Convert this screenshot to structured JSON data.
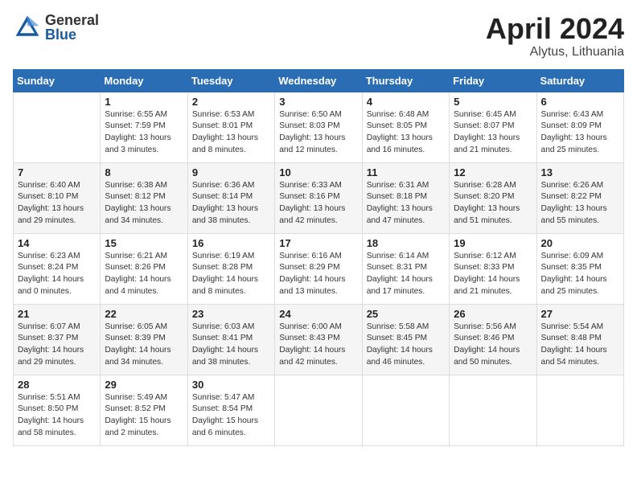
{
  "header": {
    "logo_general": "General",
    "logo_blue": "Blue",
    "month_title": "April 2024",
    "location": "Alytus, Lithuania"
  },
  "days_of_week": [
    "Sunday",
    "Monday",
    "Tuesday",
    "Wednesday",
    "Thursday",
    "Friday",
    "Saturday"
  ],
  "weeks": [
    [
      {
        "day": "",
        "info": ""
      },
      {
        "day": "1",
        "info": "Sunrise: 6:55 AM\nSunset: 7:59 PM\nDaylight: 13 hours\nand 3 minutes."
      },
      {
        "day": "2",
        "info": "Sunrise: 6:53 AM\nSunset: 8:01 PM\nDaylight: 13 hours\nand 8 minutes."
      },
      {
        "day": "3",
        "info": "Sunrise: 6:50 AM\nSunset: 8:03 PM\nDaylight: 13 hours\nand 12 minutes."
      },
      {
        "day": "4",
        "info": "Sunrise: 6:48 AM\nSunset: 8:05 PM\nDaylight: 13 hours\nand 16 minutes."
      },
      {
        "day": "5",
        "info": "Sunrise: 6:45 AM\nSunset: 8:07 PM\nDaylight: 13 hours\nand 21 minutes."
      },
      {
        "day": "6",
        "info": "Sunrise: 6:43 AM\nSunset: 8:09 PM\nDaylight: 13 hours\nand 25 minutes."
      }
    ],
    [
      {
        "day": "7",
        "info": "Sunrise: 6:40 AM\nSunset: 8:10 PM\nDaylight: 13 hours\nand 29 minutes."
      },
      {
        "day": "8",
        "info": "Sunrise: 6:38 AM\nSunset: 8:12 PM\nDaylight: 13 hours\nand 34 minutes."
      },
      {
        "day": "9",
        "info": "Sunrise: 6:36 AM\nSunset: 8:14 PM\nDaylight: 13 hours\nand 38 minutes."
      },
      {
        "day": "10",
        "info": "Sunrise: 6:33 AM\nSunset: 8:16 PM\nDaylight: 13 hours\nand 42 minutes."
      },
      {
        "day": "11",
        "info": "Sunrise: 6:31 AM\nSunset: 8:18 PM\nDaylight: 13 hours\nand 47 minutes."
      },
      {
        "day": "12",
        "info": "Sunrise: 6:28 AM\nSunset: 8:20 PM\nDaylight: 13 hours\nand 51 minutes."
      },
      {
        "day": "13",
        "info": "Sunrise: 6:26 AM\nSunset: 8:22 PM\nDaylight: 13 hours\nand 55 minutes."
      }
    ],
    [
      {
        "day": "14",
        "info": "Sunrise: 6:23 AM\nSunset: 8:24 PM\nDaylight: 14 hours\nand 0 minutes."
      },
      {
        "day": "15",
        "info": "Sunrise: 6:21 AM\nSunset: 8:26 PM\nDaylight: 14 hours\nand 4 minutes."
      },
      {
        "day": "16",
        "info": "Sunrise: 6:19 AM\nSunset: 8:28 PM\nDaylight: 14 hours\nand 8 minutes."
      },
      {
        "day": "17",
        "info": "Sunrise: 6:16 AM\nSunset: 8:29 PM\nDaylight: 14 hours\nand 13 minutes."
      },
      {
        "day": "18",
        "info": "Sunrise: 6:14 AM\nSunset: 8:31 PM\nDaylight: 14 hours\nand 17 minutes."
      },
      {
        "day": "19",
        "info": "Sunrise: 6:12 AM\nSunset: 8:33 PM\nDaylight: 14 hours\nand 21 minutes."
      },
      {
        "day": "20",
        "info": "Sunrise: 6:09 AM\nSunset: 8:35 PM\nDaylight: 14 hours\nand 25 minutes."
      }
    ],
    [
      {
        "day": "21",
        "info": "Sunrise: 6:07 AM\nSunset: 8:37 PM\nDaylight: 14 hours\nand 29 minutes."
      },
      {
        "day": "22",
        "info": "Sunrise: 6:05 AM\nSunset: 8:39 PM\nDaylight: 14 hours\nand 34 minutes."
      },
      {
        "day": "23",
        "info": "Sunrise: 6:03 AM\nSunset: 8:41 PM\nDaylight: 14 hours\nand 38 minutes."
      },
      {
        "day": "24",
        "info": "Sunrise: 6:00 AM\nSunset: 8:43 PM\nDaylight: 14 hours\nand 42 minutes."
      },
      {
        "day": "25",
        "info": "Sunrise: 5:58 AM\nSunset: 8:45 PM\nDaylight: 14 hours\nand 46 minutes."
      },
      {
        "day": "26",
        "info": "Sunrise: 5:56 AM\nSunset: 8:46 PM\nDaylight: 14 hours\nand 50 minutes."
      },
      {
        "day": "27",
        "info": "Sunrise: 5:54 AM\nSunset: 8:48 PM\nDaylight: 14 hours\nand 54 minutes."
      }
    ],
    [
      {
        "day": "28",
        "info": "Sunrise: 5:51 AM\nSunset: 8:50 PM\nDaylight: 14 hours\nand 58 minutes."
      },
      {
        "day": "29",
        "info": "Sunrise: 5:49 AM\nSunset: 8:52 PM\nDaylight: 15 hours\nand 2 minutes."
      },
      {
        "day": "30",
        "info": "Sunrise: 5:47 AM\nSunset: 8:54 PM\nDaylight: 15 hours\nand 6 minutes."
      },
      {
        "day": "",
        "info": ""
      },
      {
        "day": "",
        "info": ""
      },
      {
        "day": "",
        "info": ""
      },
      {
        "day": "",
        "info": ""
      }
    ]
  ]
}
